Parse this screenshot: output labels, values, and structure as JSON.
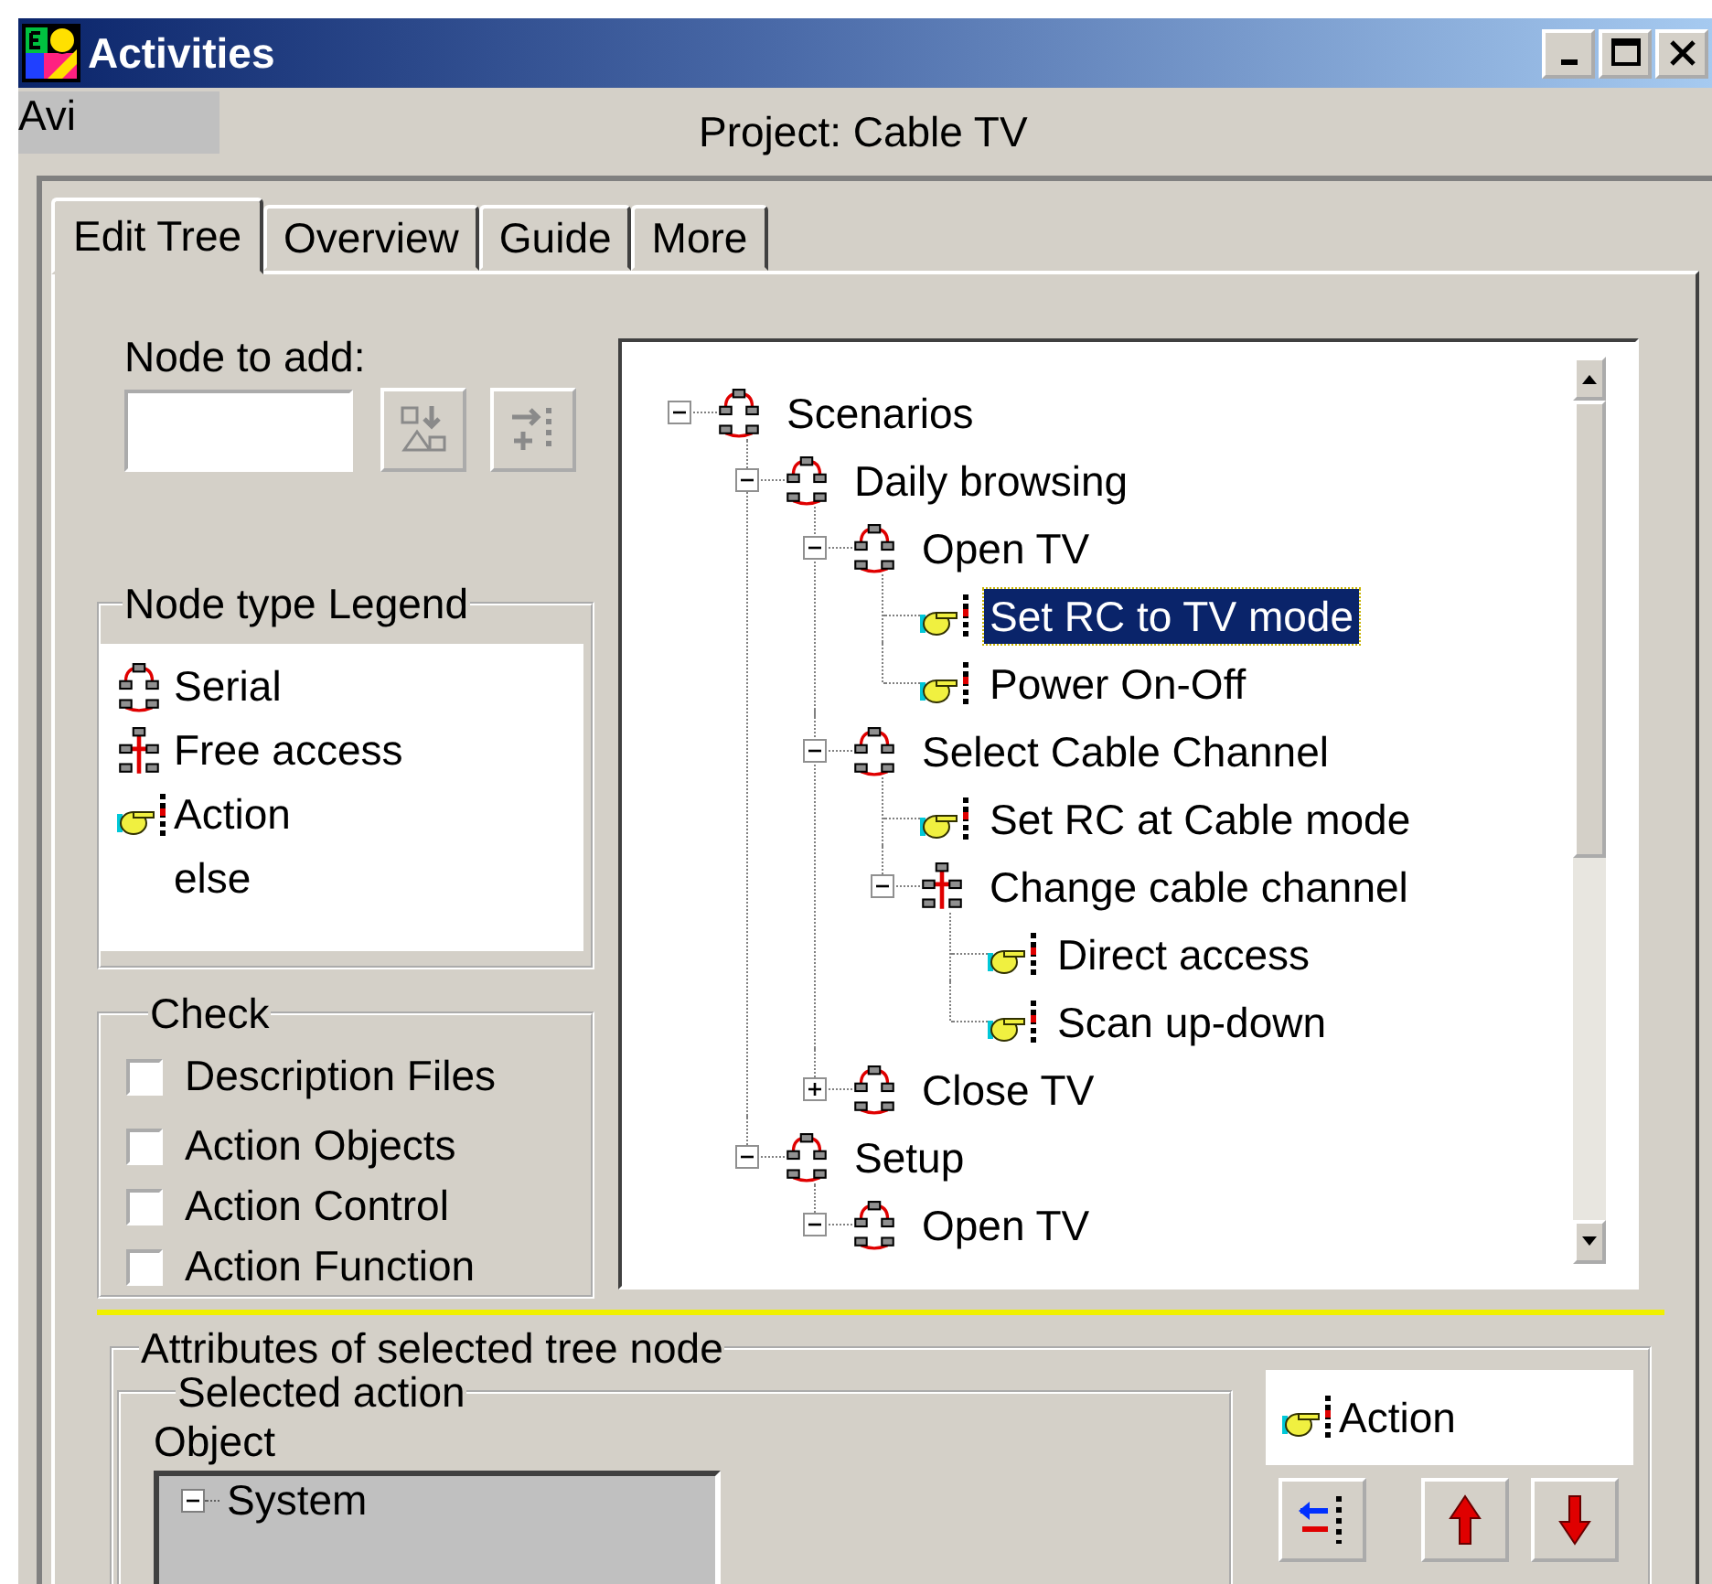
{
  "window": {
    "title": "Activities"
  },
  "user": "Avi",
  "project": "Project: Cable TV",
  "tabs": [
    {
      "label": "Edit Tree",
      "selected": true
    },
    {
      "label": "Overview",
      "selected": false
    },
    {
      "label": "Guide",
      "selected": false
    },
    {
      "label": "More",
      "selected": false
    }
  ],
  "node_to_add": {
    "label": "Node to add:",
    "buttons": [
      {
        "kind": "insert",
        "disabled": true
      },
      {
        "kind": "append",
        "disabled": true
      }
    ]
  },
  "legend": {
    "title": "Node type Legend",
    "items": [
      {
        "kind": "serial",
        "label": "Serial"
      },
      {
        "kind": "free",
        "label": "Free access"
      },
      {
        "kind": "action",
        "label": "Action"
      },
      {
        "kind": "else",
        "label": "else"
      }
    ]
  },
  "check": {
    "title": "Check",
    "items": [
      {
        "label": "Description Files",
        "checked": false
      },
      {
        "label": "Action Objects",
        "checked": false
      },
      {
        "label": "Action Control",
        "checked": false
      },
      {
        "label": "Action Function",
        "checked": false
      }
    ]
  },
  "tree": [
    {
      "label": "Scenarios",
      "kind": "serial",
      "expanded": true,
      "selected": false,
      "children": [
        {
          "label": "Daily browsing",
          "kind": "serial",
          "expanded": true,
          "selected": false,
          "children": [
            {
              "label": "Open TV",
              "kind": "serial",
              "expanded": true,
              "selected": false,
              "children": [
                {
                  "label": "Set RC to TV mode",
                  "kind": "action",
                  "selected": true
                },
                {
                  "label": "Power On-Off",
                  "kind": "action",
                  "selected": false
                }
              ]
            },
            {
              "label": "Select Cable Channel",
              "kind": "serial",
              "expanded": true,
              "selected": false,
              "children": [
                {
                  "label": "Set RC at Cable mode",
                  "kind": "action",
                  "selected": false
                },
                {
                  "label": "Change cable channel",
                  "kind": "free",
                  "expanded": true,
                  "selected": false,
                  "children": [
                    {
                      "label": "Direct access",
                      "kind": "action",
                      "selected": false
                    },
                    {
                      "label": "Scan up-down",
                      "kind": "action",
                      "selected": false
                    }
                  ]
                }
              ]
            },
            {
              "label": "Close TV",
              "kind": "serial",
              "expanded": false,
              "selected": false
            }
          ]
        },
        {
          "label": "Setup",
          "kind": "serial",
          "expanded": true,
          "selected": false,
          "children": [
            {
              "label": "Open TV",
              "kind": "serial",
              "expanded": true,
              "selected": false
            }
          ]
        }
      ]
    }
  ],
  "attributes": {
    "title": "Attributes of selected tree node",
    "selected_action": {
      "title": "Selected action",
      "object_label": "Object",
      "object_tree": [
        {
          "label": "System",
          "expanded": true
        }
      ]
    },
    "node_type": {
      "kind": "action",
      "label": "Action"
    },
    "buttons": [
      {
        "kind": "left"
      },
      {
        "kind": "up"
      },
      {
        "kind": "down"
      }
    ]
  }
}
